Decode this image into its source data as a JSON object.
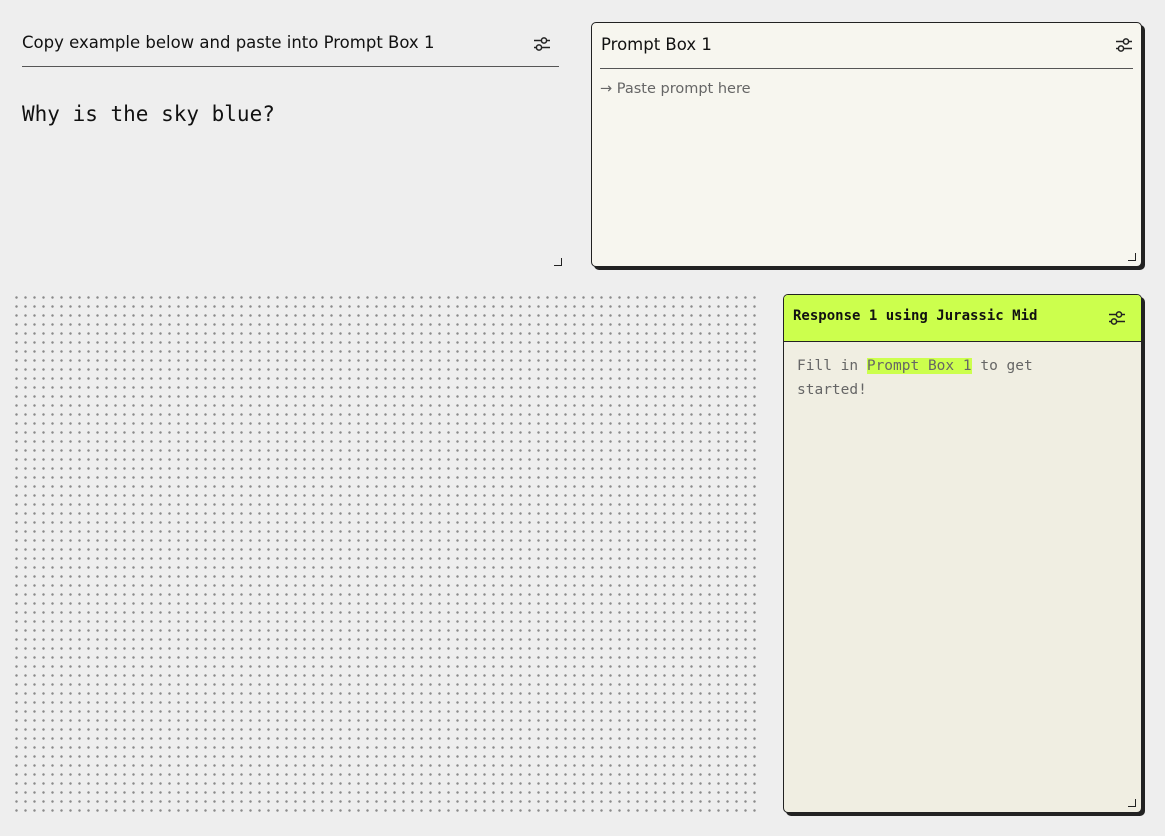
{
  "example": {
    "title": "Copy example below and paste into Prompt Box 1",
    "text": "Why is the sky blue?",
    "settings_icon": "sliders-icon"
  },
  "prompt_box": {
    "title": "Prompt Box 1",
    "placeholder": "→ Paste prompt here",
    "value": "",
    "settings_icon": "sliders-icon"
  },
  "response": {
    "title": "Response 1 using Jurassic Mid",
    "body_prefix": "Fill in ",
    "body_highlight": "Prompt Box 1",
    "body_suffix": " to get started!",
    "settings_icon": "sliders-icon"
  },
  "colors": {
    "background": "#eeeeee",
    "prompt_bg": "#f7f6ef",
    "response_bg": "#f0eee2",
    "accent": "#ccff4d",
    "border": "#222222"
  }
}
